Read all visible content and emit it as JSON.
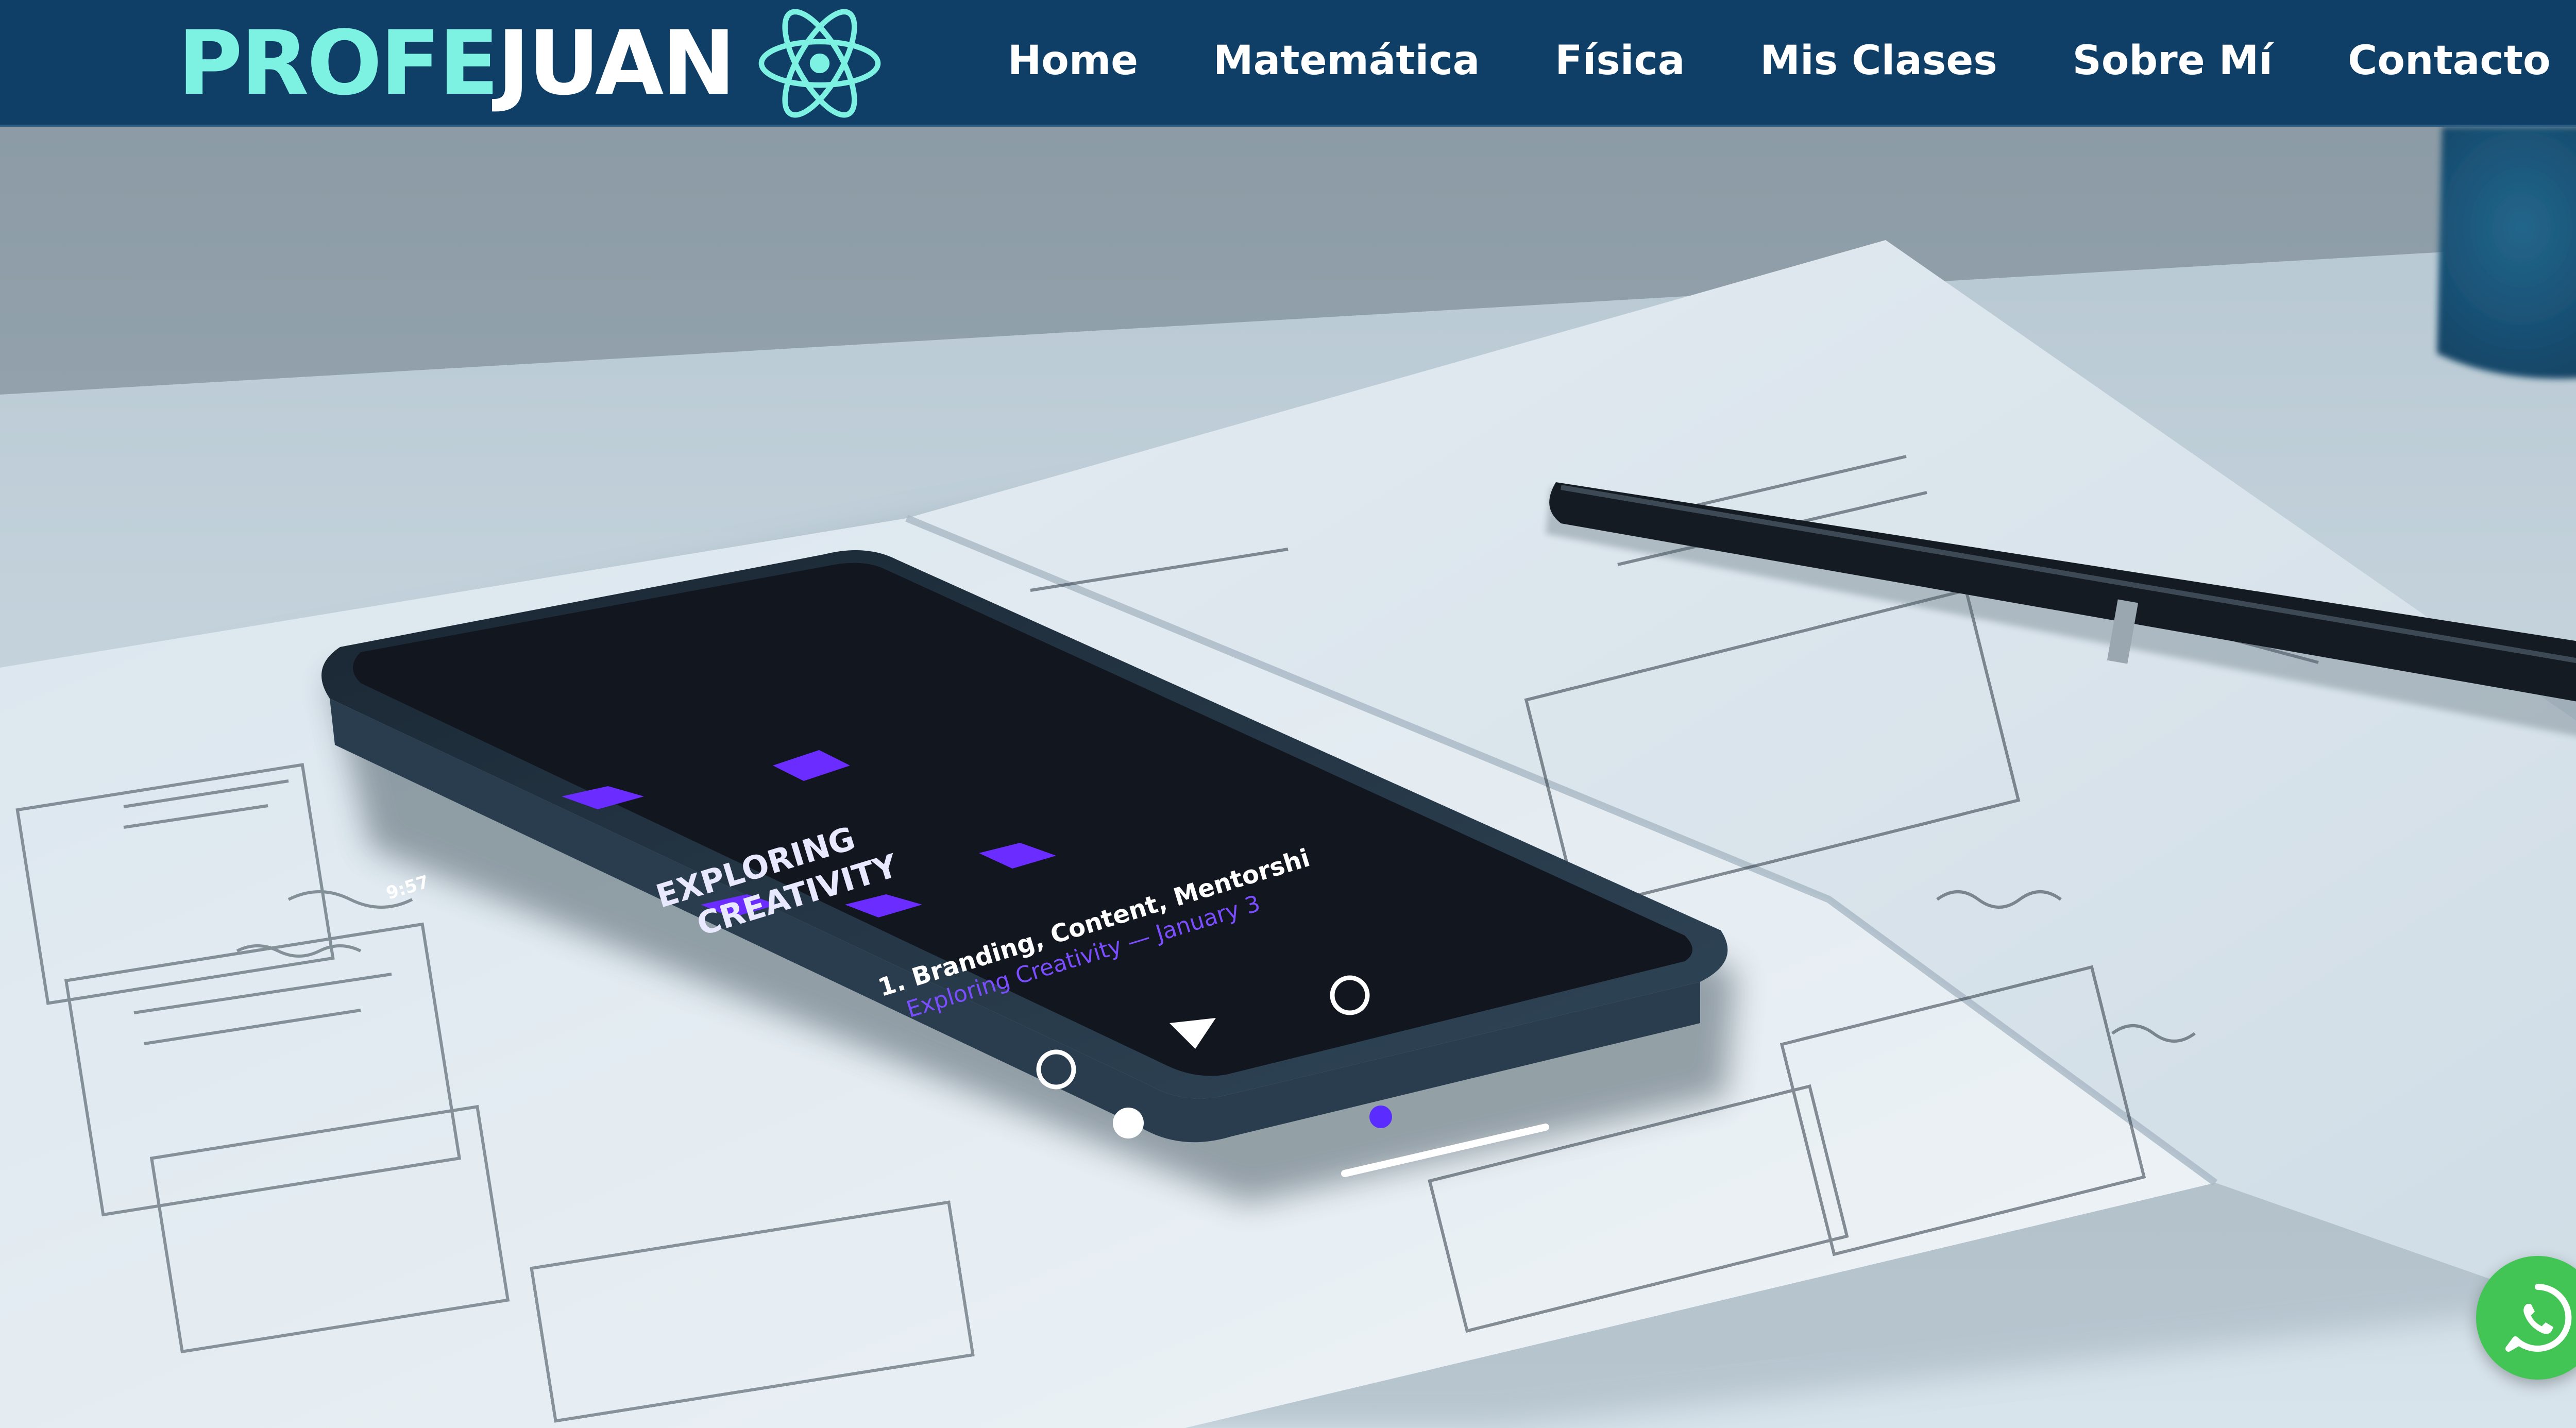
{
  "header": {
    "brand": {
      "part1": "PROFE",
      "part2": "JUAN",
      "logo_icon": "atom-icon"
    },
    "nav": [
      {
        "label": "Home"
      },
      {
        "label": "Matemática"
      },
      {
        "label": "Física"
      },
      {
        "label": "Mis Clases"
      },
      {
        "label": "Sobre Mí"
      },
      {
        "label": "Contacto"
      }
    ]
  },
  "hero": {
    "phone_screen": {
      "title_line1": "EXPLORING",
      "title_line2": "CREATIVITY",
      "track_title": "1. Branding, Content, Mentorshi",
      "track_subtitle": "Exploring Creativity — January 3",
      "status_time": "9:57"
    }
  },
  "whatsapp": {
    "icon": "whatsapp-icon"
  },
  "colors": {
    "header_bg": "#0f3f66",
    "brand_accent": "#7ef2e2",
    "nav_text": "#ffffff",
    "whatsapp_green": "#43c556"
  }
}
